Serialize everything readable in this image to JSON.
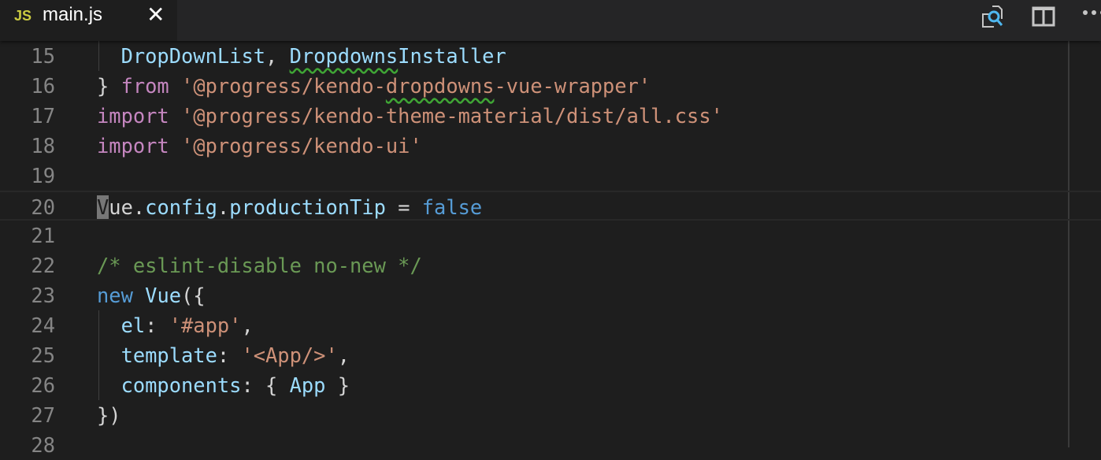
{
  "tab": {
    "icon": "JS",
    "name": "main.js",
    "close": "✕"
  },
  "actions": [
    "open-preview-icon",
    "split-editor-icon",
    "more-actions-icon"
  ],
  "lines": [
    {
      "n": "15",
      "parts": [
        [
          "  ",
          ""
        ],
        [
          "DropDownList",
          "v"
        ],
        [
          ", ",
          ""
        ],
        [
          "Dropdowns",
          "v sq"
        ],
        [
          "Installer",
          "v"
        ]
      ]
    },
    {
      "n": "16",
      "parts": [
        [
          "} ",
          ""
        ],
        [
          "from",
          "k"
        ],
        [
          " ",
          ""
        ],
        [
          "'@progress/kendo-",
          "s"
        ],
        [
          "dropdowns",
          "s sq"
        ],
        [
          "-vue-wrapper'",
          "s"
        ]
      ]
    },
    {
      "n": "17",
      "parts": [
        [
          "import",
          "k"
        ],
        [
          " ",
          ""
        ],
        [
          "'@progress/kendo-theme-material/dist/all.css'",
          "s"
        ]
      ]
    },
    {
      "n": "18",
      "parts": [
        [
          "import",
          "k"
        ],
        [
          " ",
          ""
        ],
        [
          "'@progress/kendo-ui'",
          "s"
        ]
      ]
    },
    {
      "n": "19",
      "parts": []
    },
    {
      "n": "20",
      "parts": [
        [
          "V",
          "caret"
        ],
        [
          "ue.",
          ""
        ],
        [
          "config",
          "v"
        ],
        [
          ".",
          ""
        ],
        [
          "productionTip",
          "v"
        ],
        [
          " = ",
          ""
        ],
        [
          "false",
          "b"
        ]
      ]
    },
    {
      "n": "21",
      "parts": []
    },
    {
      "n": "22",
      "parts": [
        [
          "/* eslint-disable no-new */",
          "c"
        ]
      ]
    },
    {
      "n": "23",
      "parts": [
        [
          "new",
          "b"
        ],
        [
          " ",
          ""
        ],
        [
          "Vue",
          "v"
        ],
        [
          "({",
          ""
        ]
      ]
    },
    {
      "n": "24",
      "parts": [
        [
          "  ",
          ""
        ],
        [
          "el",
          "v"
        ],
        [
          ": ",
          ""
        ],
        [
          "'#app'",
          "s"
        ],
        [
          ",",
          ""
        ]
      ]
    },
    {
      "n": "25",
      "parts": [
        [
          "  ",
          ""
        ],
        [
          "template",
          "v"
        ],
        [
          ": ",
          ""
        ],
        [
          "'<App/>'",
          "s"
        ],
        [
          ",",
          ""
        ]
      ]
    },
    {
      "n": "26",
      "parts": [
        [
          "  ",
          ""
        ],
        [
          "components",
          "v"
        ],
        [
          ": { ",
          ""
        ],
        [
          "App",
          "v"
        ],
        [
          " }",
          ""
        ]
      ]
    },
    {
      "n": "27",
      "parts": [
        [
          "})",
          ""
        ]
      ]
    },
    {
      "n": "28",
      "parts": []
    }
  ]
}
